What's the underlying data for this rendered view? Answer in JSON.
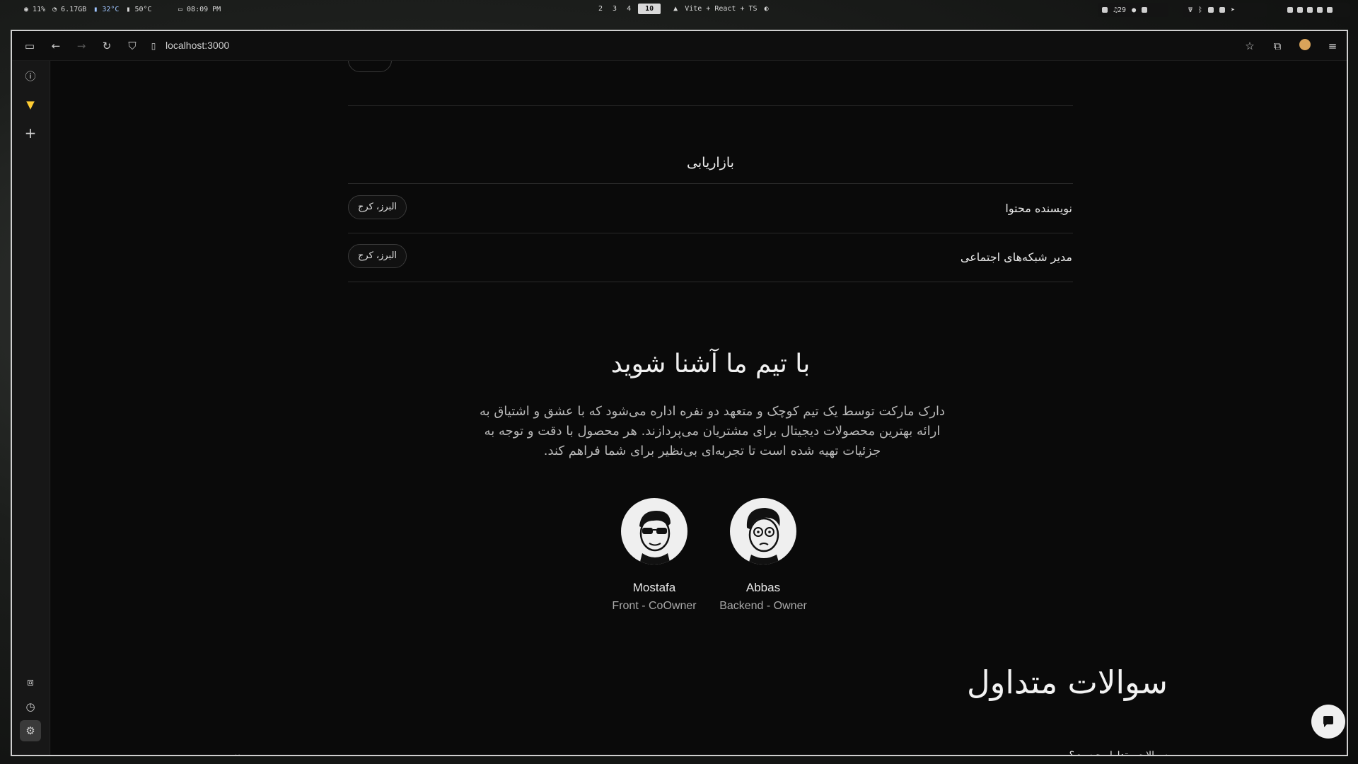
{
  "sysbar": {
    "cpu": "11%",
    "mem": "6.17GB",
    "temp1": "32°C",
    "temp2": "50°C",
    "clock": "08:09 PM",
    "workspaces": [
      "2",
      "3",
      "4",
      "10"
    ],
    "active_workspace": "10",
    "window_title": "Vite + React + TS",
    "volume": "29"
  },
  "browser": {
    "url": "localhost:3000"
  },
  "jobs": {
    "section_title": "بازاریابی",
    "items": [
      {
        "title": "نویسنده محتوا",
        "location": "البرز، کرج"
      },
      {
        "title": "مدیر شبکه‌های اجتماعی",
        "location": "البرز، کرج"
      }
    ]
  },
  "team": {
    "title": "با تیم ما آشنا شوید",
    "description_lines": [
      "دارک مارکت توسط یک تیم کوچک و متعهد دو نفره اداره می‌شود که با عشق و اشتیاق به",
      "ارائه بهترین محصولات دیجیتال برای مشتریان می‌پردازند. هر محصول با دقت و توجه به",
      "جزئیات تهیه شده است تا تجربه‌ای بی‌نظیر برای شما فراهم کند."
    ],
    "members": [
      {
        "name": "Mostafa",
        "role": "Front - CoOwner",
        "avatar": "sunglasses-face-icon"
      },
      {
        "name": "Abbas",
        "role": "Backend - Owner",
        "avatar": "glasses-face-icon"
      }
    ]
  },
  "faq": {
    "title": "سوالات متداول",
    "items": [
      {
        "question": "سوالات متداول چیست؟"
      }
    ]
  }
}
